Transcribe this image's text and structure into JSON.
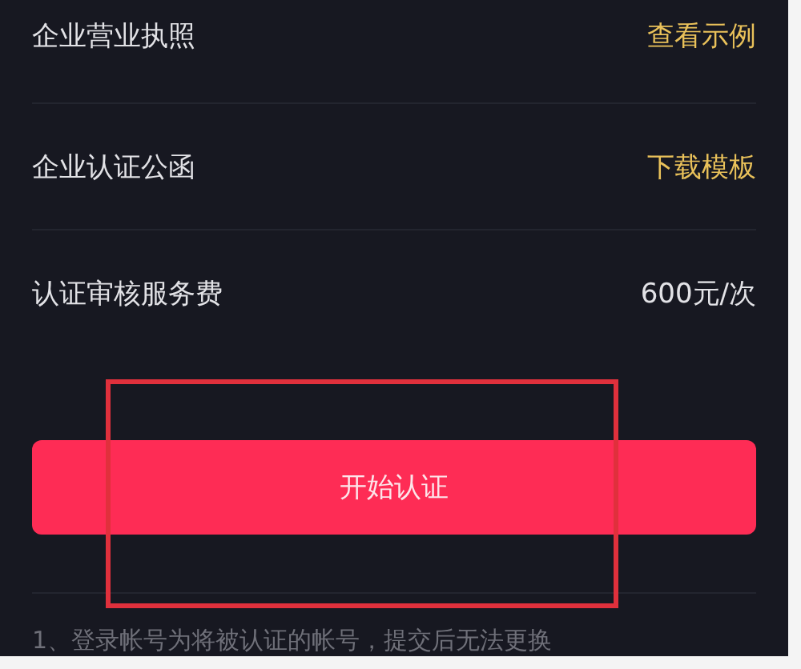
{
  "rows": [
    {
      "label": "企业营业执照",
      "value": "查看示例",
      "kind": "link"
    },
    {
      "label": "企业认证公函",
      "value": "下载模板",
      "kind": "link"
    },
    {
      "label": "认证审核服务费",
      "value": "600元/次",
      "kind": "text"
    }
  ],
  "button": {
    "label": "开始认证"
  },
  "note": "1、登录帐号为将被认证的帐号，提交后无法更换"
}
